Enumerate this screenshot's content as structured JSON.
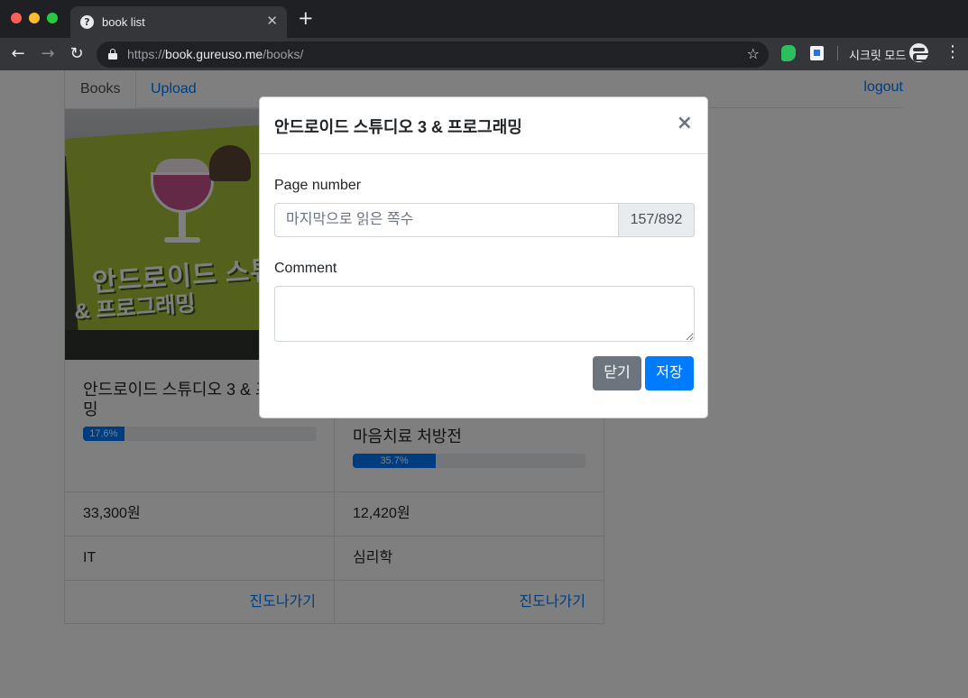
{
  "browser": {
    "tab_title": "book list",
    "url_scheme": "https://",
    "url_host": "book.gureuso.me",
    "url_path": "/books/",
    "incognito_label": "시크릿 모드"
  },
  "nav": {
    "tabs": [
      {
        "label": "Books",
        "active": true
      },
      {
        "label": "Upload",
        "active": false
      }
    ],
    "logout_label": "logout"
  },
  "books": [
    {
      "title": "안드로이드 스튜디오 3 & 프로그래밍",
      "progress_label": "17.6%",
      "progress_fraction": 0.176,
      "price": "33,300원",
      "category": "IT",
      "link_label": "진도나가기",
      "cover_text": {
        "headline": "안드로이드 스튜디오",
        "subline": "& 프로그래밍"
      }
    },
    {
      "title": "마음치료 처방전",
      "progress_label": "35.7%",
      "progress_fraction": 0.357,
      "price": "12,420원",
      "category": "심리학",
      "link_label": "진도나가기"
    }
  ],
  "modal": {
    "title": "안드로이드 스튜디오 3 & 프로그래밍",
    "page_label": "Page number",
    "page_placeholder": "마지막으로 읽은 쪽수",
    "page_value": "",
    "page_total": "157/892",
    "comment_label": "Comment",
    "comment_value": "",
    "close_button": "닫기",
    "save_button": "저장"
  },
  "colors": {
    "primary": "#007bff",
    "secondary": "#6c757d",
    "backdrop": "rgba(0,0,0,0.5)"
  },
  "icons": [
    "help-icon",
    "tab-close-icon",
    "new-tab-icon",
    "back-icon",
    "forward-icon",
    "reload-icon",
    "lock-icon",
    "star-icon",
    "evernote-icon",
    "extension-icon",
    "incognito-icon",
    "menu-icon",
    "modal-close-icon"
  ]
}
